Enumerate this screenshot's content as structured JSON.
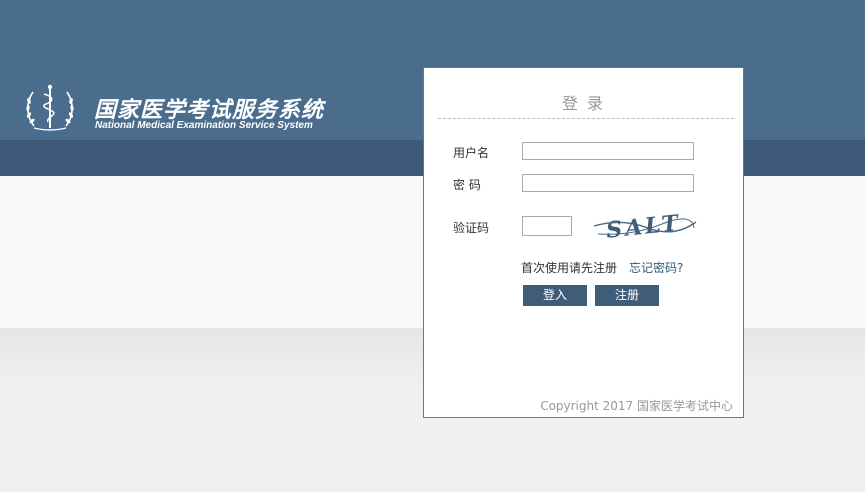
{
  "header": {
    "title": "国家医学考试服务系统",
    "subtitle": "National Medical Examination Service System"
  },
  "login": {
    "title": "登 录",
    "username_label": "用户名",
    "username_value": "",
    "password_label": "密 码",
    "password_value": "",
    "captcha_label": "验证码",
    "captcha_value": "",
    "captcha_text": "SALT",
    "first_use_text": "首次使用请先注册",
    "forgot_link": "忘记密码?",
    "login_button": "登入",
    "register_button": "注册",
    "copyright": "Copyright 2017 国家医学考试中心"
  },
  "colors": {
    "header_blue": "#4a6d8e",
    "header_dark_band": "#3d5b78",
    "button_blue": "#3f5d79",
    "link_blue": "#2d5a7d"
  }
}
